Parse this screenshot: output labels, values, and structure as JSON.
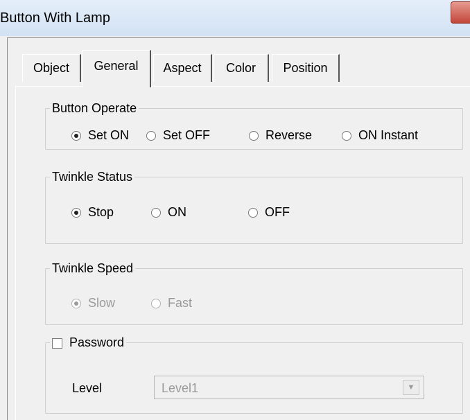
{
  "window": {
    "title": "Button With Lamp"
  },
  "tabs": [
    {
      "label": "Object",
      "active": false
    },
    {
      "label": "General",
      "active": true
    },
    {
      "label": "Aspect",
      "active": false
    },
    {
      "label": "Color",
      "active": false
    },
    {
      "label": "Position",
      "active": false
    }
  ],
  "button_operate": {
    "legend": "Button Operate",
    "options": [
      "Set ON",
      "Set OFF",
      "Reverse",
      "ON Instant"
    ],
    "selected": "Set ON"
  },
  "twinkle_status": {
    "legend": "Twinkle Status",
    "options": [
      "Stop",
      "ON",
      "OFF"
    ],
    "selected": "Stop"
  },
  "twinkle_speed": {
    "legend": "Twinkle Speed",
    "options": [
      "Slow",
      "Fast"
    ],
    "selected": "Slow",
    "enabled": false
  },
  "password": {
    "label": "Password",
    "checked": false,
    "level_label": "Level",
    "level_value": "Level1"
  }
}
